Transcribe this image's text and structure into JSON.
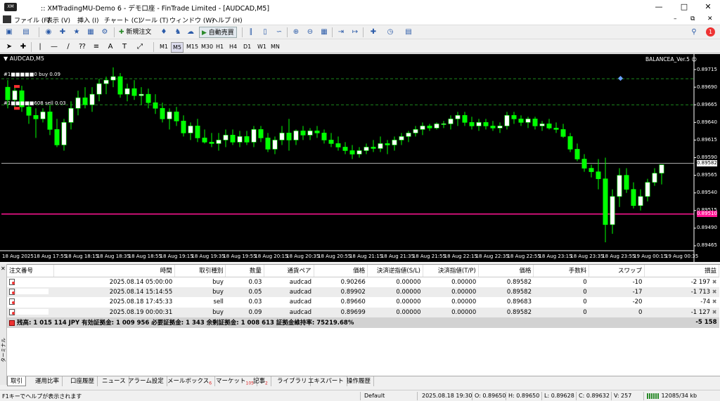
{
  "title": "XMTradingMU-Demo 6 - デモ口座 - FinTrade Limited - [AUDCAD,M5]",
  "title_prefix": "::",
  "menu": [
    "ファイル (F)",
    "表示 (V)",
    "挿入 (I)",
    "チャート (C)",
    "ツール (T)",
    "ウィンドウ (W)",
    "ヘルプ (H)"
  ],
  "toolbar": {
    "new_order": "新規注文",
    "auto_trade": "自動売買"
  },
  "timeframes": [
    "M1",
    "M5",
    "M15",
    "M30",
    "H1",
    "H4",
    "D1",
    "W1",
    "MN"
  ],
  "active_timeframe": "M5",
  "chart": {
    "symbol": "AUDCAD,M5",
    "ea_name": "BALANCEA_Ver.5",
    "order_line_1": "#1■■■■■0 buy 0.09",
    "order_line_2": "#1■■■■■608 sell 0.03",
    "current_price": "0.89582",
    "marked_price": "0.89510",
    "colors": {
      "background": "#000000",
      "bull": "#ffffff",
      "bear": "#00ff00",
      "bid_line": "#a9a9a9",
      "ask_line": "#ff1493",
      "order_line": "#1e8a1e"
    },
    "price_labels": [
      "0.89715",
      "0.89690",
      "0.89665",
      "0.89640",
      "0.89615",
      "0.89590",
      "0.89565",
      "0.89540",
      "0.89515",
      "0.89490",
      "0.89465"
    ],
    "time_labels": [
      "18 Aug 2025",
      "18 Aug 17:55",
      "18 Aug 18:15",
      "18 Aug 18:35",
      "18 Aug 18:55",
      "18 Aug 19:15",
      "18 Aug 19:35",
      "18 Aug 19:55",
      "18 Aug 20:15",
      "18 Aug 20:35",
      "18 Aug 20:55",
      "18 Aug 21:15",
      "18 Aug 21:35",
      "18 Aug 21:55",
      "18 Aug 22:15",
      "18 Aug 22:35",
      "18 Aug 22:55",
      "18 Aug 23:15",
      "18 Aug 23:35",
      "18 Aug 23:55",
      "19 Aug 00:15",
      "19 Aug 00:35"
    ]
  },
  "chart_data": {
    "type": "candlestick",
    "y_range": [
      0.89458,
      0.89725
    ],
    "y_ticks": [
      0.89715,
      0.8969,
      0.89665,
      0.8964,
      0.89615,
      0.8959,
      0.89565,
      0.8954,
      0.89515,
      0.8949,
      0.89465
    ],
    "horizontal_lines": [
      0.89702,
      0.89665,
      0.89582,
      0.8951
    ],
    "candles": [
      [
        0.8969,
        0.897,
        0.8966,
        0.89672
      ],
      [
        0.89672,
        0.8969,
        0.8966,
        0.89685
      ],
      [
        0.89685,
        0.89692,
        0.89655,
        0.89662
      ],
      [
        0.89662,
        0.8967,
        0.89638,
        0.8965
      ],
      [
        0.8965,
        0.8966,
        0.89618,
        0.89645
      ],
      [
        0.89645,
        0.8966,
        0.8964,
        0.89655
      ],
      [
        0.89655,
        0.89665,
        0.89622,
        0.8963
      ],
      [
        0.8963,
        0.89645,
        0.89605,
        0.89608
      ],
      [
        0.89608,
        0.89645,
        0.896,
        0.8964
      ],
      [
        0.8964,
        0.8967,
        0.8963,
        0.8966
      ],
      [
        0.8966,
        0.89685,
        0.8965,
        0.89675
      ],
      [
        0.89675,
        0.8969,
        0.8966,
        0.89665
      ],
      [
        0.89665,
        0.8969,
        0.89655,
        0.8968
      ],
      [
        0.8968,
        0.89702,
        0.8967,
        0.89695
      ],
      [
        0.89695,
        0.89705,
        0.8968,
        0.897
      ],
      [
        0.897,
        0.89718,
        0.8969,
        0.89705
      ],
      [
        0.89705,
        0.8971,
        0.89675,
        0.8968
      ],
      [
        0.8968,
        0.89695,
        0.8967,
        0.89688
      ],
      [
        0.89688,
        0.897,
        0.89672,
        0.89678
      ],
      [
        0.89678,
        0.8969,
        0.89665,
        0.8968
      ],
      [
        0.8968,
        0.89688,
        0.8966,
        0.89668
      ],
      [
        0.89668,
        0.8968,
        0.89652,
        0.8966
      ],
      [
        0.8966,
        0.89668,
        0.8964,
        0.89645
      ],
      [
        0.89645,
        0.8966,
        0.8963,
        0.89655
      ],
      [
        0.89655,
        0.89662,
        0.89635,
        0.89642
      ],
      [
        0.89642,
        0.8965,
        0.8962,
        0.89625
      ],
      [
        0.89625,
        0.8964,
        0.89615,
        0.89635
      ],
      [
        0.89635,
        0.89645,
        0.89612,
        0.89618
      ],
      [
        0.89618,
        0.8963,
        0.8961,
        0.89612
      ],
      [
        0.89612,
        0.89625,
        0.89605,
        0.8961
      ],
      [
        0.8961,
        0.89625,
        0.896,
        0.89615
      ],
      [
        0.89615,
        0.8963,
        0.89605,
        0.89622
      ],
      [
        0.89622,
        0.8963,
        0.89608,
        0.89612
      ],
      [
        0.89612,
        0.89628,
        0.89605,
        0.8962
      ],
      [
        0.8962,
        0.89628,
        0.89608,
        0.89612
      ],
      [
        0.89612,
        0.89635,
        0.89605,
        0.8963
      ],
      [
        0.8963,
        0.89635,
        0.89612,
        0.89618
      ],
      [
        0.89618,
        0.89625,
        0.89598,
        0.89602
      ],
      [
        0.89602,
        0.8962,
        0.89595,
        0.89615
      ],
      [
        0.89615,
        0.89635,
        0.89608,
        0.89625
      ],
      [
        0.89625,
        0.89645,
        0.896,
        0.89615
      ],
      [
        0.89615,
        0.8963,
        0.89608,
        0.89628
      ],
      [
        0.89628,
        0.89635,
        0.89615,
        0.89622
      ],
      [
        0.89622,
        0.89632,
        0.89615,
        0.89628
      ],
      [
        0.89628,
        0.89635,
        0.89618,
        0.89625
      ],
      [
        0.89625,
        0.8963,
        0.8961,
        0.89615
      ],
      [
        0.89615,
        0.89625,
        0.89605,
        0.8961
      ],
      [
        0.8961,
        0.8962,
        0.896,
        0.89605
      ],
      [
        0.89605,
        0.89612,
        0.89595,
        0.896
      ],
      [
        0.896,
        0.89608,
        0.89588,
        0.89595
      ],
      [
        0.89595,
        0.89605,
        0.8959,
        0.896
      ],
      [
        0.896,
        0.8961,
        0.89595,
        0.89605
      ],
      [
        0.89605,
        0.89615,
        0.89598,
        0.89603
      ],
      [
        0.89603,
        0.8962,
        0.89598,
        0.8961
      ],
      [
        0.8961,
        0.89615,
        0.89595,
        0.89608
      ],
      [
        0.89608,
        0.8962,
        0.896,
        0.89615
      ],
      [
        0.89615,
        0.89625,
        0.89608,
        0.8962
      ],
      [
        0.8962,
        0.89628,
        0.89612,
        0.89625
      ],
      [
        0.89625,
        0.89635,
        0.8962,
        0.8963
      ],
      [
        0.8963,
        0.8964,
        0.89622,
        0.89635
      ],
      [
        0.89635,
        0.89638,
        0.89628,
        0.89632
      ],
      [
        0.89632,
        0.8964,
        0.8963,
        0.89638
      ],
      [
        0.89638,
        0.89642,
        0.89632,
        0.89638
      ],
      [
        0.89638,
        0.8965,
        0.8963,
        0.89645
      ],
      [
        0.89645,
        0.89655,
        0.89635,
        0.8965
      ],
      [
        0.8965,
        0.89655,
        0.89635,
        0.8964
      ],
      [
        0.8964,
        0.89648,
        0.8963,
        0.89635
      ],
      [
        0.89635,
        0.89645,
        0.89628,
        0.8964
      ],
      [
        0.8964,
        0.89645,
        0.8963,
        0.89635
      ],
      [
        0.89635,
        0.89642,
        0.89628,
        0.89632
      ],
      [
        0.89632,
        0.8964,
        0.89625,
        0.89635
      ],
      [
        0.89635,
        0.89655,
        0.8963,
        0.8965
      ],
      [
        0.8965,
        0.89655,
        0.89638,
        0.89645
      ],
      [
        0.89645,
        0.8965,
        0.89635,
        0.8964
      ],
      [
        0.8964,
        0.89648,
        0.89632,
        0.89645
      ],
      [
        0.89645,
        0.89648,
        0.8963,
        0.89635
      ],
      [
        0.89635,
        0.89642,
        0.89628,
        0.89638
      ],
      [
        0.89638,
        0.89645,
        0.8963,
        0.89632
      ],
      [
        0.89632,
        0.8964,
        0.89625,
        0.8963
      ],
      [
        0.8963,
        0.89638,
        0.89618,
        0.8962
      ],
      [
        0.8962,
        0.89625,
        0.89598,
        0.89602
      ],
      [
        0.89602,
        0.8961,
        0.89585,
        0.89588
      ],
      [
        0.89588,
        0.89595,
        0.8957,
        0.89575
      ],
      [
        0.89575,
        0.8958,
        0.89562,
        0.8957
      ],
      [
        0.8957,
        0.89588,
        0.89545,
        0.8956
      ],
      [
        0.8956,
        0.8959,
        0.8947,
        0.89495
      ],
      [
        0.89495,
        0.89545,
        0.89482,
        0.89535
      ],
      [
        0.89535,
        0.89575,
        0.8952,
        0.89565
      ],
      [
        0.89565,
        0.89575,
        0.8954,
        0.89545
      ],
      [
        0.89545,
        0.89555,
        0.89518,
        0.89522
      ],
      [
        0.89522,
        0.89545,
        0.89515,
        0.89535
      ],
      [
        0.89535,
        0.8956,
        0.89528,
        0.89555
      ],
      [
        0.89555,
        0.89575,
        0.8955,
        0.89568
      ],
      [
        0.89568,
        0.8958,
        0.89552,
        0.8958
      ]
    ]
  },
  "terminal": {
    "headers": [
      "注文番号",
      "時間",
      "取引種別",
      "数量",
      "通貨ペア",
      "価格",
      "決済逆指値(S/L)",
      "決済指値(T/P)",
      "価格",
      "手数料",
      "スワップ",
      "損益"
    ],
    "rows": [
      {
        "time": "2025.08.14 05:00:00",
        "type": "buy",
        "volume": "0.03",
        "symbol": "audcad",
        "price": "0.90266",
        "sl": "0.00000",
        "tp": "0.00000",
        "cur": "0.89582",
        "commission": "0",
        "swap": "-10",
        "profit": "-2 197"
      },
      {
        "time": "2025.08.14 15:14:55",
        "type": "buy",
        "volume": "0.05",
        "symbol": "audcad",
        "price": "0.89902",
        "sl": "0.00000",
        "tp": "0.00000",
        "cur": "0.89582",
        "commission": "0",
        "swap": "-17",
        "profit": "-1 713"
      },
      {
        "time": "2025.08.18 17:45:33",
        "type": "sell",
        "volume": "0.03",
        "symbol": "audcad",
        "price": "0.89660",
        "sl": "0.00000",
        "tp": "0.00000",
        "cur": "0.89683",
        "commission": "0",
        "swap": "-20",
        "profit": "-74"
      },
      {
        "time": "2025.08.19 00:00:31",
        "type": "buy",
        "volume": "0.09",
        "symbol": "audcad",
        "price": "0.89699",
        "sl": "0.00000",
        "tp": "0.00000",
        "cur": "0.89582",
        "commission": "0",
        "swap": "0",
        "profit": "-1 127"
      }
    ],
    "summary": "残高: 1 015 114 JPY  有効証拠金: 1 009 956  必要証拠金: 1 343  余剰証拠金: 1 008 613  証拠金維持率: 75219.68%",
    "summary_profit": "-5 158",
    "side_label": "ターミナル",
    "tabs": [
      {
        "label": "取引",
        "badge": ""
      },
      {
        "label": "運用比率",
        "badge": ""
      },
      {
        "label": "口座履歴",
        "badge": ""
      },
      {
        "label": "ニュース",
        "badge": ""
      },
      {
        "label": "アラーム設定",
        "badge": ""
      },
      {
        "label": "メールボックス",
        "badge": "6"
      },
      {
        "label": "マーケット",
        "badge": "105"
      },
      {
        "label": "記事",
        "badge": "2"
      },
      {
        "label": "ライブラリ",
        "badge": ""
      },
      {
        "label": "エキスパート",
        "badge": ""
      },
      {
        "label": "操作履歴",
        "badge": ""
      }
    ]
  },
  "status": {
    "help": "F1キーでヘルプが表示されます",
    "profile": "Default",
    "time": "2025.08.18 19:30",
    "open": "O: 0.89650",
    "high": "H: 0.89650",
    "low": "L: 0.89628",
    "close": "C: 0.89632",
    "volume": "V: 257",
    "traffic": "12085/34 kb"
  }
}
